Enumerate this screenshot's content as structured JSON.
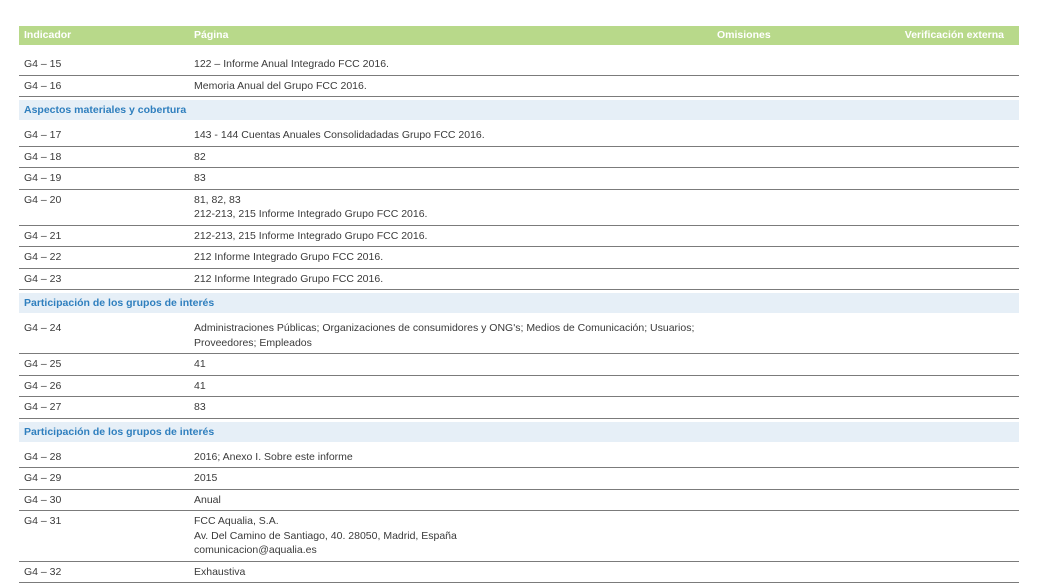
{
  "header": {
    "indicador": "Indicador",
    "pagina": "Página",
    "omisiones": "Omisiones",
    "verificacion": "Verificación externa"
  },
  "group0": [
    {
      "ind": "G4 – 15",
      "pag": "122 – Informe Anual Integrado FCC 2016."
    },
    {
      "ind": "G4 – 16",
      "pag": "Memoria Anual del Grupo FCC 2016."
    }
  ],
  "section1": "Aspectos materiales y cobertura",
  "group1": [
    {
      "ind": "G4 – 17",
      "pag": "143 - 144 Cuentas Anuales Consolidadadas Grupo FCC 2016."
    },
    {
      "ind": "G4 – 18",
      "pag": "82"
    },
    {
      "ind": "G4 – 19",
      "pag": "83"
    },
    {
      "ind": "G4 – 20",
      "pag": "81, 82, 83\n212-213, 215 Informe Integrado Grupo FCC 2016."
    },
    {
      "ind": "G4 – 21",
      "pag": "212-213, 215 Informe Integrado Grupo FCC 2016."
    },
    {
      "ind": "G4 – 22",
      "pag": "212 Informe Integrado Grupo FCC 2016."
    },
    {
      "ind": "G4 – 23",
      "pag": "212 Informe Integrado Grupo FCC 2016."
    }
  ],
  "section2": "Participación de los grupos de interés",
  "group2": [
    {
      "ind": "G4 – 24",
      "pag": "Administraciones Públicas; Organizaciones de consumidores y ONG's; Medios de Comunicación; Usuarios;\nProveedores; Empleados"
    },
    {
      "ind": "G4 – 25",
      "pag": "41"
    },
    {
      "ind": "G4 – 26",
      "pag": "41"
    },
    {
      "ind": "G4 – 27",
      "pag": "83"
    }
  ],
  "section3": "Participación de los grupos de interés",
  "group3": [
    {
      "ind": "G4 – 28",
      "pag": "2016; Anexo I. Sobre este informe"
    },
    {
      "ind": "G4 – 29",
      "pag": "2015"
    },
    {
      "ind": "G4 – 30",
      "pag": "Anual"
    },
    {
      "ind": "G4 – 31",
      "pag": "FCC Aqualia, S.A.\nAv. Del Camino de Santiago, 40. 28050, Madrid, España\ncomunicacion@aqualia.es"
    },
    {
      "ind": "G4 – 32",
      "pag": "Exhaustiva"
    }
  ]
}
